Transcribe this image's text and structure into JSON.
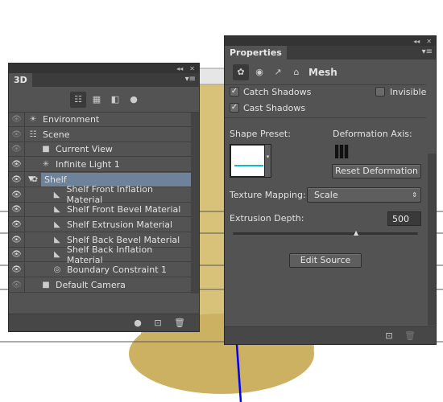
{
  "panel_3d": {
    "tab": "3D",
    "tools": [
      "scene-filter-icon",
      "mesh-filter-icon",
      "material-filter-icon",
      "light-filter-icon"
    ],
    "layers": [
      {
        "label": "Environment",
        "icon": "environment-icon",
        "visible": false,
        "indent": 0
      },
      {
        "label": "Scene",
        "icon": "scene-icon",
        "visible": false,
        "indent": 0
      },
      {
        "label": "Current View",
        "icon": "camera-icon",
        "visible": false,
        "indent": 1
      },
      {
        "label": "Infinite Light 1",
        "icon": "light-icon",
        "visible": true,
        "indent": 1
      },
      {
        "label": "Shelf",
        "icon": "mesh-icon",
        "visible": true,
        "indent": 1,
        "selected": true
      },
      {
        "label": "Shelf Front Inflation Material",
        "icon": "material-icon",
        "visible": true,
        "indent": 2
      },
      {
        "label": "Shelf Front Bevel Material",
        "icon": "material-icon",
        "visible": true,
        "indent": 2
      },
      {
        "label": "Shelf Extrusion Material",
        "icon": "material-icon",
        "visible": true,
        "indent": 2
      },
      {
        "label": "Shelf Back Bevel Material",
        "icon": "material-icon",
        "visible": true,
        "indent": 2
      },
      {
        "label": "Shelf Back Inflation Material",
        "icon": "material-icon",
        "visible": true,
        "indent": 2
      },
      {
        "label": "Boundary Constraint 1",
        "icon": "constraint-icon",
        "visible": true,
        "indent": 2
      },
      {
        "label": "Default Camera",
        "icon": "camera-icon",
        "visible": false,
        "indent": 1
      }
    ]
  },
  "properties": {
    "tab": "Properties",
    "section": "Mesh",
    "catch_shadows": {
      "label": "Catch Shadows",
      "checked": true
    },
    "cast_shadows": {
      "label": "Cast Shadows",
      "checked": true
    },
    "invisible": {
      "label": "Invisible",
      "checked": false
    },
    "shape_preset_label": "Shape Preset:",
    "deformation_axis_label": "Deformation Axis:",
    "reset_deformation": "Reset Deformation",
    "texture_mapping_label": "Texture Mapping:",
    "texture_mapping_value": "Scale",
    "extrusion_depth_label": "Extrusion Depth:",
    "extrusion_depth_value": "500",
    "edit_source": "Edit Source"
  },
  "colors": {
    "selection": "#6e8299",
    "panel": "#535353",
    "axis_line": "#0000ff"
  }
}
